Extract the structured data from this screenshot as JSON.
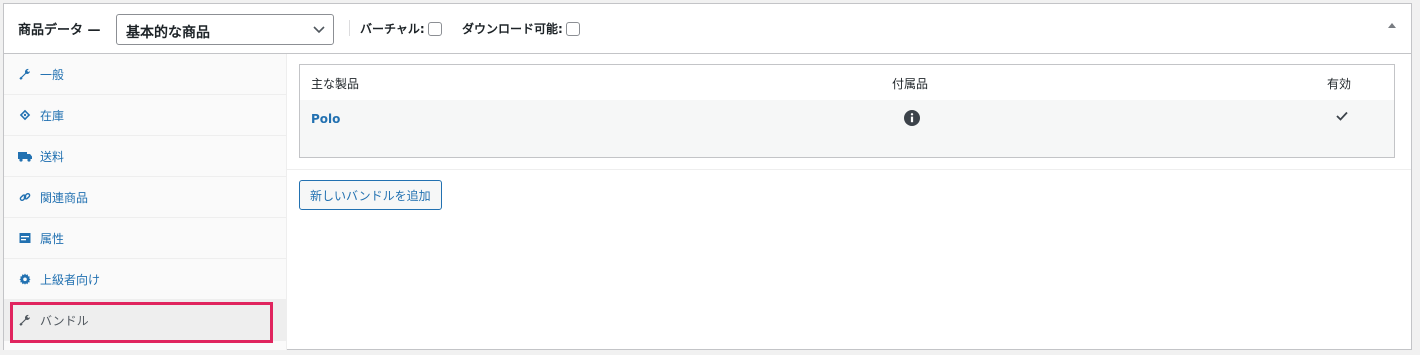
{
  "header": {
    "title": "商品データ —",
    "product_type": "基本的な商品",
    "virtual_label": "バーチャル:",
    "downloadable_label": "ダウンロード可能:"
  },
  "tabs": [
    {
      "label": "一般",
      "icon": "wrench-icon"
    },
    {
      "label": "在庫",
      "icon": "tag-icon"
    },
    {
      "label": "送料",
      "icon": "truck-icon"
    },
    {
      "label": "関連商品",
      "icon": "link-icon"
    },
    {
      "label": "属性",
      "icon": "list-icon"
    },
    {
      "label": "上級者向け",
      "icon": "gear-icon"
    },
    {
      "label": "バンドル",
      "icon": "wrench-icon",
      "active": true
    }
  ],
  "table": {
    "headers": [
      "主な製品",
      "付属品",
      "有効"
    ],
    "rows": [
      {
        "product": "Polo"
      }
    ]
  },
  "add_bundle_button": "新しいバンドルを追加",
  "colors": {
    "accent": "#2271b1",
    "highlight": "#e0245e"
  }
}
